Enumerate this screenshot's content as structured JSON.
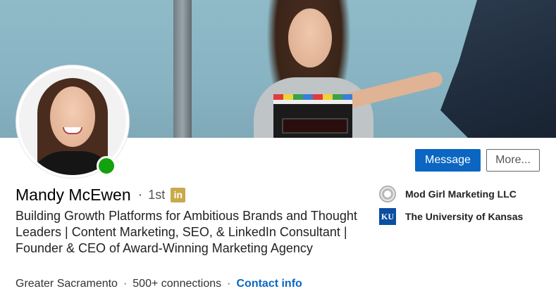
{
  "profile": {
    "name": "Mandy McEwen",
    "separator": "·",
    "degree": "1st",
    "badge_icon": "linkedin-premium-icon",
    "badge_text": "in",
    "online_status_color": "#13a10e",
    "headline": "Building Growth Platforms for Ambitious Brands and Thought Leaders | Content Marketing, SEO, & LinkedIn Consultant | Founder & CEO of Award-Winning Marketing Agency",
    "location": "Greater Sacramento",
    "connections": "500+ connections",
    "contact_info": "Contact info"
  },
  "actions": {
    "message_label": "Message",
    "more_label": "More..."
  },
  "sidebar": {
    "company": {
      "label": "Mod Girl Marketing LLC",
      "icon": "company-logo-icon"
    },
    "education": {
      "label": "The University of Kansas",
      "icon": "university-logo-icon",
      "logo_text": "KU"
    }
  },
  "colors": {
    "accent": "#0a66c2",
    "premium_badge": "#c9a94a"
  }
}
